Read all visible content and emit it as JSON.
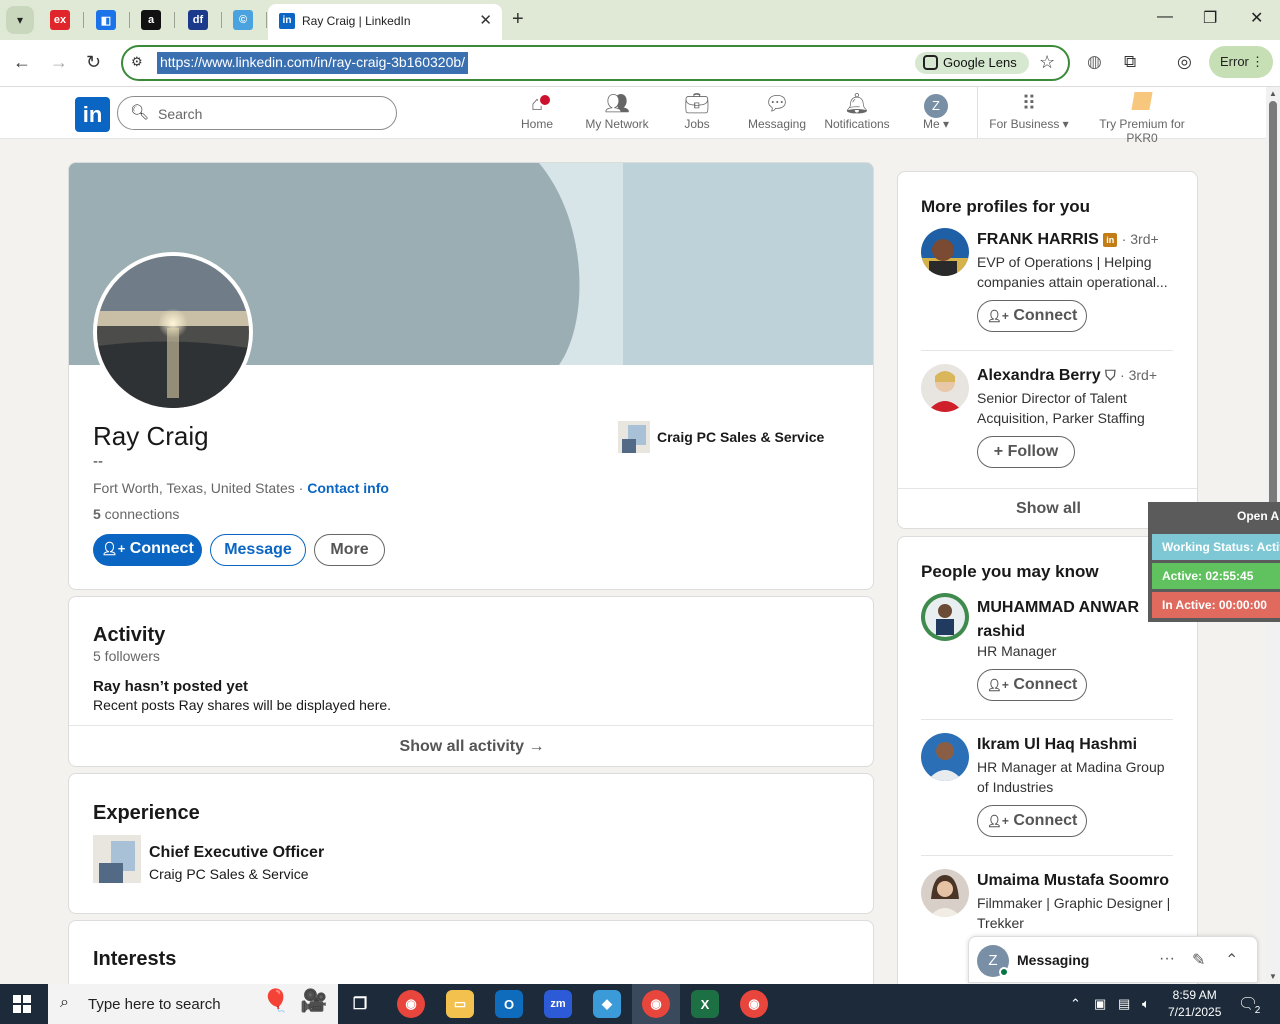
{
  "browser": {
    "tabs": [
      {
        "name": "tab-favicon-exam",
        "glyph": "ex",
        "color": "#e0262b"
      },
      {
        "name": "tab-favicon-sheets",
        "glyph": "◧",
        "color": "#1a73e8"
      },
      {
        "name": "tab-favicon-amazon",
        "glyph": "a",
        "color": "#111111"
      },
      {
        "name": "tab-favicon-df",
        "glyph": "df",
        "color": "#1b3a8c"
      },
      {
        "name": "tab-favicon-c",
        "glyph": "©",
        "color": "#4aa3df"
      }
    ],
    "active_tab_title": "Ray Craig | LinkedIn",
    "url": "https://www.linkedin.com/in/ray-craig-3b160320b/",
    "lens_label": "Google Lens",
    "error_label": "Error"
  },
  "header": {
    "search_placeholder": "Search",
    "nav": {
      "home": "Home",
      "network": "My Network",
      "jobs": "Jobs",
      "messaging": "Messaging",
      "notifications": "Notifications",
      "me": "Me",
      "me_initial": "Z",
      "business": "For Business",
      "premium": "Try Premium for PKR0"
    }
  },
  "profile": {
    "name": "Ray Craig",
    "headline": "--",
    "location": "Fort Worth, Texas, United States",
    "separator": " · ",
    "contact_info": "Contact info",
    "connections_count": "5",
    "connections_label": " connections",
    "company": "Craig PC Sales & Service",
    "actions": {
      "connect": "Connect",
      "message": "Message",
      "more": "More"
    }
  },
  "activity": {
    "title": "Activity",
    "followers": "5 followers",
    "empty_title": "Ray hasn’t posted yet",
    "empty_body": "Recent posts Ray shares will be displayed here.",
    "show_all": "Show all activity →"
  },
  "experience": {
    "title": "Experience",
    "items": [
      {
        "role": "Chief Executive Officer",
        "company": "Craig PC Sales & Service"
      }
    ]
  },
  "interests": {
    "title": "Interests"
  },
  "more_profiles": {
    "title": "More profiles for you",
    "people": [
      {
        "name": "FRANK HARRIS",
        "degree": "3rd+",
        "headline": "EVP of Operations | Helping companies attain operational...",
        "action": "Connect"
      },
      {
        "name": "Alexandra Berry",
        "degree": "3rd+",
        "headline": "Senior Director of Talent Acquisition, Parker Staffing",
        "action": "Follow"
      }
    ],
    "show_all": "Show all"
  },
  "people_you_may_know": {
    "title": "People you may know",
    "people": [
      {
        "name": "MUHAMMAD ANWAR rashid",
        "headline": "HR Manager",
        "action": "Connect"
      },
      {
        "name": "Ikram Ul Haq Hashmi",
        "headline": "HR Manager at Madina Group of Industries",
        "action": "Connect"
      },
      {
        "name": "Umaima Mustafa Soomro",
        "headline": "Filmmaker | Graphic Designer | Trekker"
      }
    ]
  },
  "widget": {
    "open": "Open Ap",
    "working": "Working Status: Active",
    "active": "Active: 02:55:45",
    "inactive": "In Active: 00:00:00",
    "colors": {
      "working": "#7ec8d6",
      "active": "#5fc25f",
      "inactive": "#e06a5e"
    }
  },
  "messaging": {
    "label": "Messaging",
    "initial": "Z"
  },
  "taskbar": {
    "search_placeholder": "Type here to search",
    "time": "8:59 AM",
    "date": "7/21/2025",
    "notif_count": "2"
  }
}
